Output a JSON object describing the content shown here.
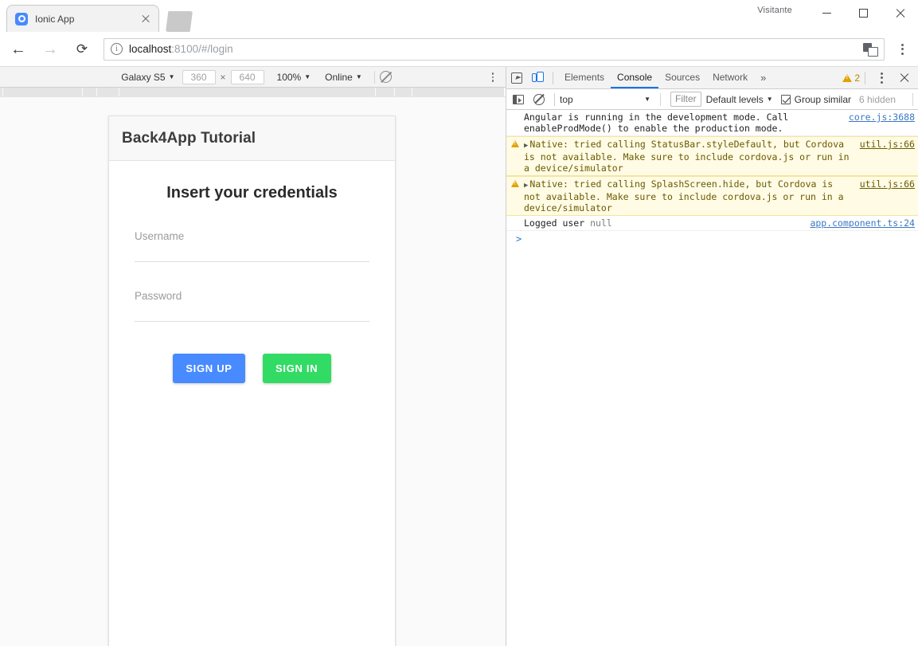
{
  "browser": {
    "profile_label": "Visitante",
    "window_controls": {
      "minimize": "minimize-button",
      "maximize": "maximize-button",
      "close": "close-button"
    },
    "tab": {
      "title": "Ionic App",
      "favicon": "ionic-icon",
      "close": "×"
    },
    "new_tab_label": "+",
    "nav": {
      "back": "←",
      "forward": "→",
      "reload": "⟳"
    },
    "omnibox": {
      "secure_icon": "i",
      "url_host": "localhost",
      "url_rest": ":8100/#/login",
      "full_url": "localhost:8100/#/login",
      "translate_icon": "translate-icon"
    },
    "menu_icon": "kebab-menu-icon"
  },
  "device_toolbar": {
    "device": "Galaxy S5",
    "width": "360",
    "height": "640",
    "times": "×",
    "zoom": "100%",
    "network": "Online",
    "throttle_icon": "no-throttling-icon",
    "caret": "▼"
  },
  "app": {
    "header_title": "Back4App Tutorial",
    "form_heading": "Insert your credentials",
    "fields": [
      {
        "name": "username",
        "placeholder": "Username",
        "value": ""
      },
      {
        "name": "password",
        "placeholder": "Password",
        "value": ""
      }
    ],
    "buttons": [
      {
        "name": "sign-up",
        "label": "SIGN UP",
        "color": "#488aff"
      },
      {
        "name": "sign-in",
        "label": "SIGN IN",
        "color": "#32db64"
      }
    ]
  },
  "devtools": {
    "tabs": [
      {
        "label": "Elements",
        "active": false
      },
      {
        "label": "Console",
        "active": true
      },
      {
        "label": "Sources",
        "active": false
      },
      {
        "label": "Network",
        "active": false
      }
    ],
    "more_tabs": "»",
    "warning_count": "2",
    "inspect_icon": "inspect-element-icon",
    "device_toolbar_icon": "toggle-device-toolbar-icon",
    "settings_icon": "kebab-menu-icon",
    "close_icon": "close-devtools-icon",
    "filterbar": {
      "sidebar_icon": "console-sidebar-icon",
      "clear_icon": "clear-console-icon",
      "context": "top",
      "context_caret": "▼",
      "filter_placeholder": "Filter",
      "levels": "Default levels",
      "levels_caret": "▼",
      "group_similar": "Group similar",
      "group_similar_checked": true,
      "hidden_count": "6 hidden"
    },
    "messages": [
      {
        "level": "log",
        "expandable": false,
        "text": "Angular is running in the development mode. Call enableProdMode() to enable the production mode.",
        "source": "core.js:3688"
      },
      {
        "level": "warning",
        "expandable": true,
        "text": "Native: tried calling StatusBar.styleDefault, but Cordova is not available. Make sure to include cordova.js or run in a device/simulator",
        "source": "util.js:66"
      },
      {
        "level": "warning",
        "expandable": true,
        "text": "Native: tried calling SplashScreen.hide, but Cordova is not available. Make sure to include cordova.js or run in a device/simulator",
        "source": "util.js:66"
      },
      {
        "level": "log",
        "expandable": false,
        "text": "Logged user ",
        "text_extra": "null",
        "source": "app.component.ts:24"
      }
    ],
    "prompt": ">"
  }
}
